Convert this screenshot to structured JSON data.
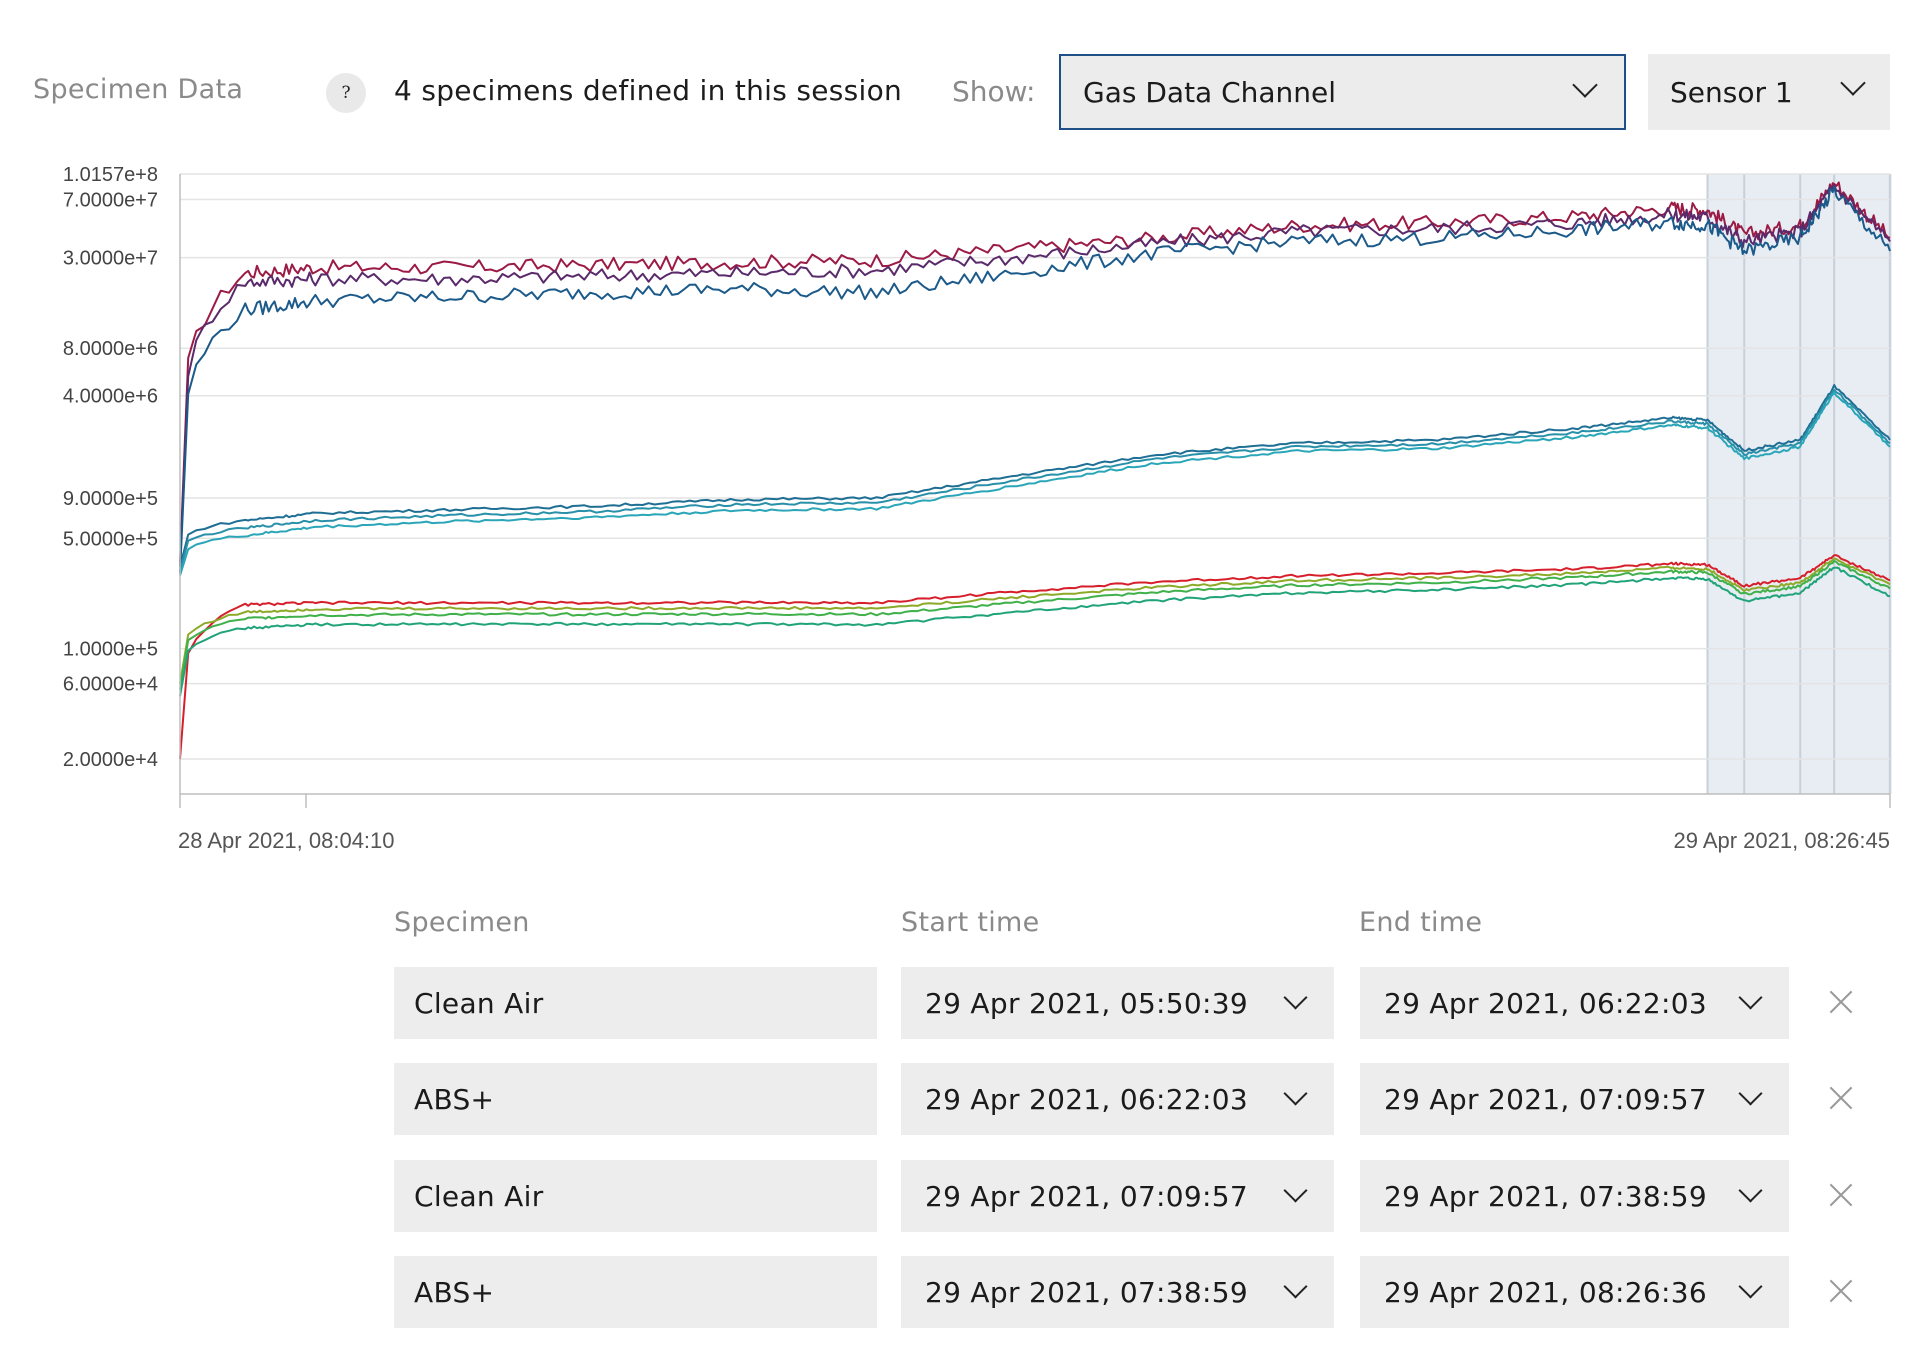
{
  "header": {
    "title": "Specimen Data",
    "help_icon": "?",
    "session_text": "4 specimens defined in this session",
    "show_label": "Show:",
    "channel_dropdown": "Gas Data Channel",
    "sensor_dropdown": "Sensor 1"
  },
  "colors": {
    "accent": "#1e4f86",
    "series_dark_red": "#9b1b45",
    "series_purple": "#5a2a6a",
    "series_blue": "#1c5a8a",
    "series_teal_dark": "#1f6f94",
    "series_teal": "#2890a8",
    "series_cyan": "#2aa6b8",
    "series_red": "#d61f2a",
    "series_olive": "#8caa28",
    "series_green": "#3fb04a",
    "series_seagreen": "#21a37a",
    "selection_fill": "#e8edf4"
  },
  "chart_data": {
    "type": "line",
    "y_scale": "log",
    "yticks": [
      "1.0157e+8",
      "7.0000e+7",
      "3.0000e+7",
      "8.0000e+6",
      "4.0000e+6",
      "9.0000e+5",
      "5.0000e+5",
      "1.0000e+5",
      "6.0000e+4",
      "2.0000e+4"
    ],
    "ylim": [
      12000,
      101570000
    ],
    "x_start_label": "28 Apr 2021, 08:04:10",
    "x_end_label": "29 Apr 2021, 08:26:45",
    "grid": true,
    "legend": "none",
    "x": [
      "28 Apr 2021, 08:04:10",
      "28 Apr 2021, 09:00:00",
      "28 Apr 2021, 10:00:00",
      "28 Apr 2021, 12:00:00",
      "28 Apr 2021, 14:00:00",
      "28 Apr 2021, 16:00:00",
      "28 Apr 2021, 18:00:00",
      "28 Apr 2021, 20:00:00",
      "28 Apr 2021, 22:00:00",
      "29 Apr 2021, 00:00:00",
      "29 Apr 2021, 02:00:00",
      "29 Apr 2021, 04:00:00",
      "29 Apr 2021, 05:20:00",
      "29 Apr 2021, 05:50:39",
      "29 Apr 2021, 06:22:03",
      "29 Apr 2021, 07:09:57",
      "29 Apr 2021, 07:38:59",
      "29 Apr 2021, 08:26:45"
    ],
    "series": [
      {
        "color": "#9b1b45",
        "values": [
          350000,
          24000000,
          26000000,
          26000000,
          27000000,
          28000000,
          29000000,
          34000000,
          40000000,
          48000000,
          50000000,
          55000000,
          62000000,
          60000000,
          42000000,
          48000000,
          90000000,
          40000000
        ]
      },
      {
        "color": "#5a2a6a",
        "values": [
          330000,
          21000000,
          22000000,
          22000000,
          23000000,
          24000000,
          25000000,
          30000000,
          37000000,
          44000000,
          46000000,
          50000000,
          56000000,
          54000000,
          38000000,
          44000000,
          85000000,
          38000000
        ]
      },
      {
        "color": "#1c5a8a",
        "values": [
          300000,
          14000000,
          16000000,
          17000000,
          18000000,
          19000000,
          18000000,
          24000000,
          32000000,
          38000000,
          40000000,
          45000000,
          50000000,
          48000000,
          33000000,
          40000000,
          80000000,
          33000000
        ]
      },
      {
        "color": "#1f6f94",
        "values": [
          330000,
          650000,
          720000,
          760000,
          800000,
          880000,
          900000,
          1250000,
          1700000,
          2000000,
          2100000,
          2500000,
          2900000,
          2800000,
          1800000,
          2100000,
          4600000,
          2100000
        ]
      },
      {
        "color": "#2890a8",
        "values": [
          310000,
          580000,
          650000,
          700000,
          740000,
          820000,
          840000,
          1170000,
          1600000,
          1900000,
          1980000,
          2350000,
          2750000,
          2650000,
          1700000,
          2000000,
          4400000,
          2000000
        ]
      },
      {
        "color": "#2aa6b8",
        "values": [
          290000,
          520000,
          590000,
          640000,
          680000,
          750000,
          770000,
          1080000,
          1500000,
          1780000,
          1850000,
          2200000,
          2600000,
          2500000,
          1600000,
          1900000,
          4200000,
          1900000
        ]
      },
      {
        "color": "#d61f2a",
        "values": [
          20000,
          190000,
          195000,
          195000,
          195000,
          196000,
          195000,
          230000,
          265000,
          290000,
          300000,
          320000,
          345000,
          340000,
          250000,
          280000,
          390000,
          270000
        ]
      },
      {
        "color": "#8caa28",
        "values": [
          60000,
          170000,
          178000,
          180000,
          180000,
          181000,
          180000,
          212000,
          245000,
          270000,
          280000,
          300000,
          325000,
          320000,
          235000,
          262000,
          370000,
          255000
        ]
      },
      {
        "color": "#3fb04a",
        "values": [
          55000,
          155000,
          163000,
          165000,
          165000,
          166000,
          165000,
          195000,
          228000,
          252000,
          262000,
          283000,
          308000,
          303000,
          222000,
          248000,
          355000,
          240000
        ]
      },
      {
        "color": "#21a37a",
        "values": [
          50000,
          135000,
          142000,
          143000,
          143000,
          143000,
          142000,
          170000,
          202000,
          226000,
          236000,
          255000,
          280000,
          275000,
          200000,
          225000,
          330000,
          215000
        ]
      }
    ],
    "specimen_markers": [
      "29 Apr 2021, 05:50:39",
      "29 Apr 2021, 06:22:03",
      "29 Apr 2021, 07:09:57",
      "29 Apr 2021, 07:38:59",
      "29 Apr 2021, 08:26:36"
    ]
  },
  "table": {
    "headers": {
      "specimen": "Specimen",
      "start": "Start time",
      "end": "End time"
    },
    "rows": [
      {
        "specimen": "Clean Air",
        "start": "29 Apr 2021, 05:50:39",
        "end": "29 Apr 2021, 06:22:03"
      },
      {
        "specimen": "ABS+",
        "start": "29 Apr 2021, 06:22:03",
        "end": "29 Apr 2021, 07:09:57"
      },
      {
        "specimen": "Clean Air",
        "start": "29 Apr 2021, 07:09:57",
        "end": "29 Apr 2021, 07:38:59"
      },
      {
        "specimen": "ABS+",
        "start": "29 Apr 2021, 07:38:59",
        "end": "29 Apr 2021, 08:26:36"
      }
    ]
  }
}
